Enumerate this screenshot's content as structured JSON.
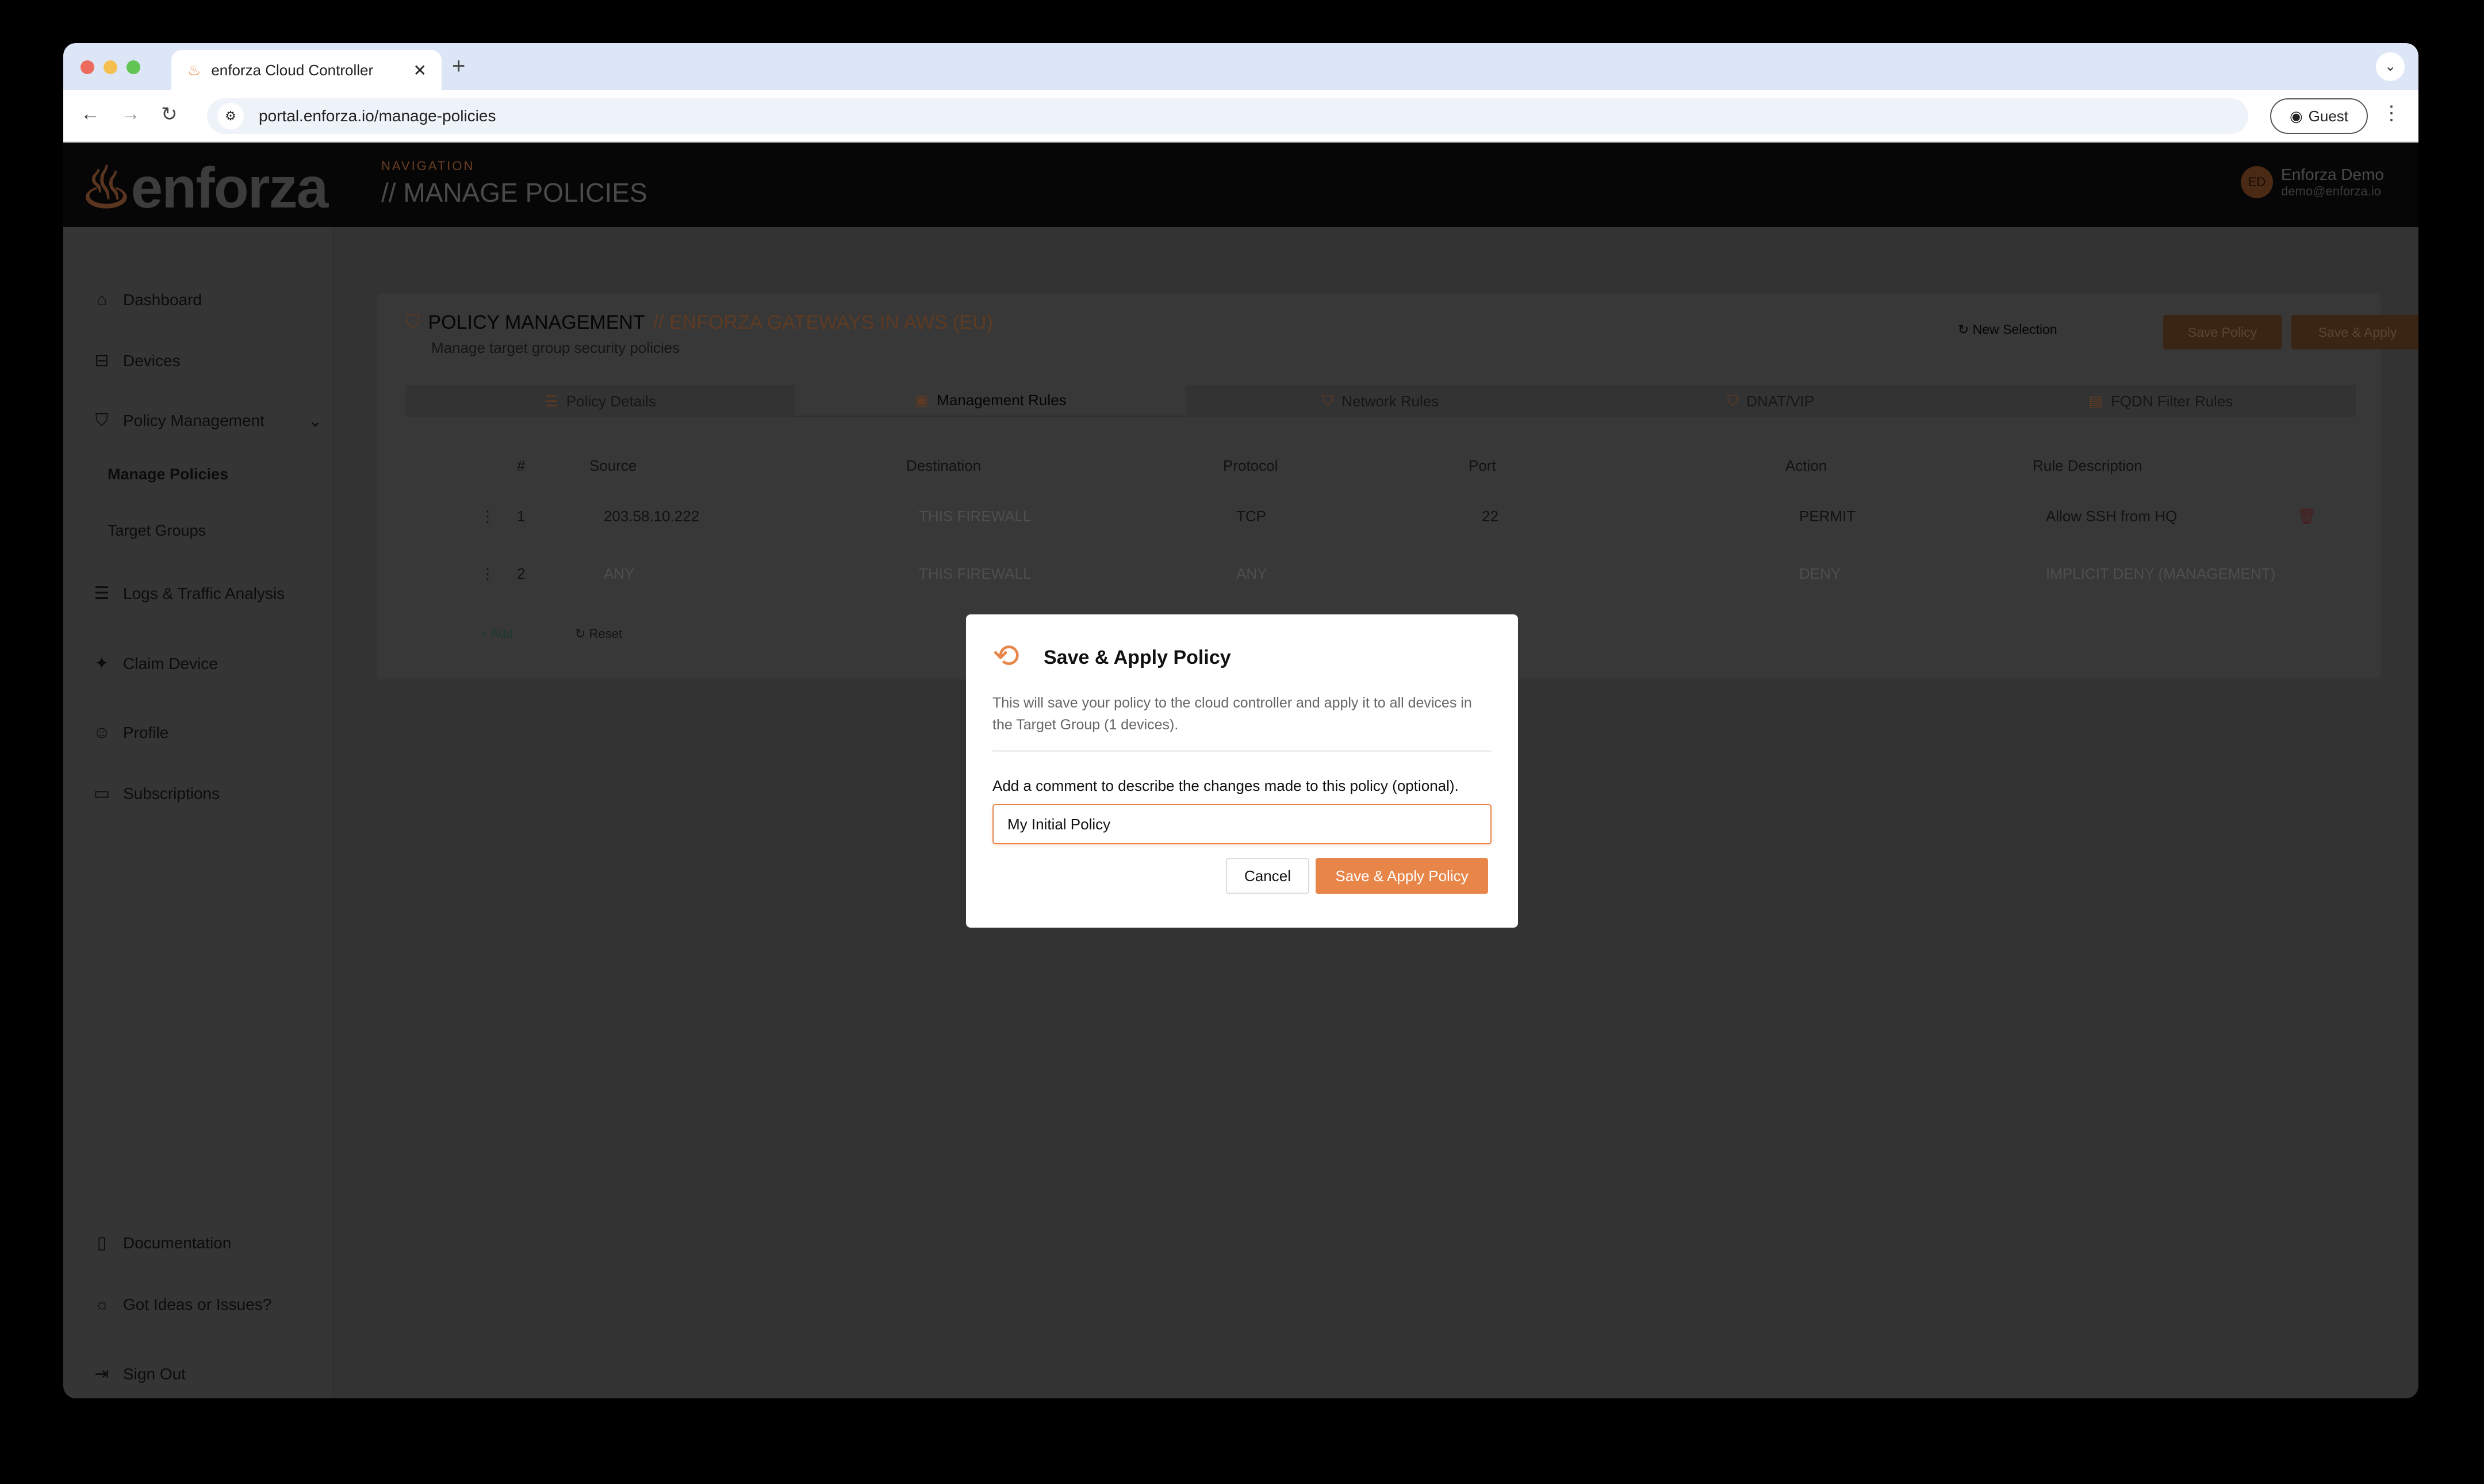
{
  "browser": {
    "tab_title": "enforza Cloud Controller",
    "url": "portal.enforza.io/manage-policies",
    "profile": "Guest",
    "traffic_colors": [
      "#ed6a5e",
      "#f5bf4f",
      "#61c554"
    ]
  },
  "header": {
    "logo": "enforza",
    "nav_label": "NAVIGATION",
    "nav_title": "// MANAGE POLICIES",
    "user_initials": "ED",
    "user_name": "Enforza Demo",
    "user_email": "demo@enforza.io"
  },
  "sidebar": {
    "items": [
      {
        "label": "Dashboard"
      },
      {
        "label": "Devices"
      },
      {
        "label": "Policy Management"
      },
      {
        "label": "Manage Policies"
      },
      {
        "label": "Target Groups"
      },
      {
        "label": "Logs & Traffic Analysis"
      },
      {
        "label": "Claim Device"
      },
      {
        "label": "Profile"
      },
      {
        "label": "Subscriptions"
      },
      {
        "label": "Documentation"
      },
      {
        "label": "Got Ideas or Issues?"
      },
      {
        "label": "Sign Out"
      }
    ]
  },
  "page": {
    "title": "POLICY MANAGEMENT",
    "title_accent": "// ENFORZA GATEWAYS IN AWS (EU)",
    "subtitle": "Manage target group security policies",
    "new_selection": "New Selection",
    "save_policy": "Save Policy",
    "save_apply": "Save & Apply",
    "tabs": [
      {
        "label": "Policy Details"
      },
      {
        "label": "Management Rules"
      },
      {
        "label": "Network Rules"
      },
      {
        "label": "DNAT/VIP"
      },
      {
        "label": "FQDN Filter Rules"
      }
    ],
    "columns": [
      "#",
      "Source",
      "Destination",
      "Protocol",
      "Port",
      "Action",
      "Rule Description"
    ],
    "rows": [
      {
        "num": "1",
        "source": "203.58.10.222",
        "destination": "THIS FIREWALL",
        "protocol": "TCP",
        "port": "22",
        "action": "PERMIT",
        "description": "Allow SSH from HQ"
      },
      {
        "num": "2",
        "source": "ANY",
        "destination": "THIS FIREWALL",
        "protocol": "ANY",
        "port": "",
        "action": "DENY",
        "description": "IMPLICIT DENY (MANAGEMENT)"
      }
    ],
    "add": "Add",
    "reset": "Reset"
  },
  "modal": {
    "title": "Save & Apply Policy",
    "description": "This will save your policy to the cloud controller and apply it to all devices in the Target Group (1 devices).",
    "comment_label": "Add a comment to describe the changes made to this policy (optional).",
    "comment_value": "My Initial Policy",
    "cancel": "Cancel",
    "confirm": "Save & Apply Policy",
    "accent": "#e8864a"
  }
}
